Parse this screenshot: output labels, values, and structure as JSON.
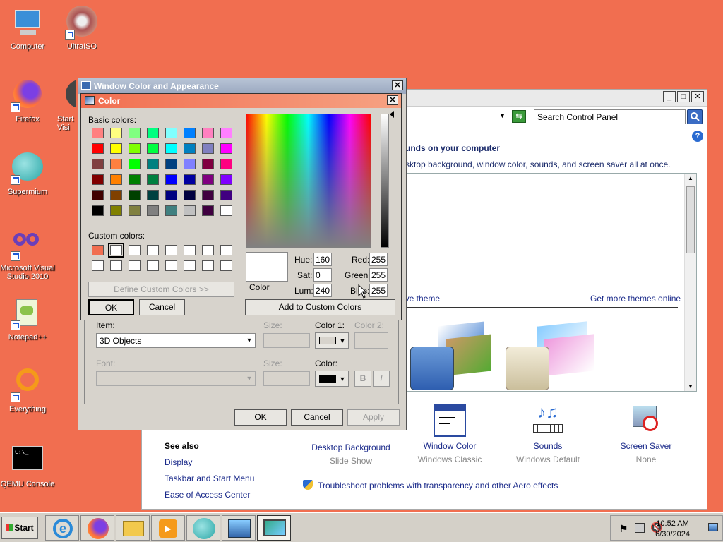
{
  "desktop": {
    "icons": [
      {
        "label": "Computer",
        "icon": "computer-icon"
      },
      {
        "label": "UltraISO",
        "icon": "ultraiso-icon"
      },
      {
        "label": "Firefox",
        "icon": "firefox-icon"
      },
      {
        "label": "Start Visi",
        "icon": "visio-icon"
      },
      {
        "label": "Supermium",
        "icon": "supermium-icon"
      },
      {
        "label": "Microsoft Visual Studio 2010",
        "icon": "visual-studio-icon"
      },
      {
        "label": "Notepad++",
        "icon": "notepadpp-icon"
      },
      {
        "label": "Everything",
        "icon": "everything-icon"
      },
      {
        "label": "QEMU Console",
        "icon": "console-icon"
      }
    ],
    "background": "#f16e50"
  },
  "control_panel": {
    "search_placeholder": "Search Control Panel",
    "heading": "unds on your computer",
    "subheading": "sktop background, window color, sounds, and screen saver all at once.",
    "save_theme": "Save theme",
    "more_themes": "Get more themes online",
    "bottom_items": [
      {
        "title": "Desktop Background",
        "subtitle": "Slide Show"
      },
      {
        "title": "Window Color",
        "subtitle": "Windows Classic"
      },
      {
        "title": "Sounds",
        "subtitle": "Windows Default"
      },
      {
        "title": "Screen Saver",
        "subtitle": "None"
      }
    ],
    "see_also": {
      "heading": "See also",
      "links": [
        "Display",
        "Taskbar and Start Menu",
        "Ease of Access Center"
      ]
    },
    "troubleshoot": "Troubleshoot problems with transparency and other Aero effects"
  },
  "wca_dialog": {
    "title": "Window Color and Appearance",
    "item_label": "Item:",
    "item_value": "3D Objects",
    "size_label": "Size:",
    "color1_label": "Color 1:",
    "color2_label": "Color 2:",
    "font_label": "Font:",
    "font_size_label": "Size:",
    "font_color_label": "Color:",
    "bold_label": "B",
    "italic_label": "I",
    "ok": "OK",
    "cancel": "Cancel",
    "apply": "Apply"
  },
  "color_dialog": {
    "title": "Color",
    "basic_colors_label": "Basic colors:",
    "custom_colors_label": "Custom colors:",
    "define_custom": "Define Custom Colors >>",
    "ok": "OK",
    "cancel": "Cancel",
    "add_custom": "Add to Custom Colors",
    "color_label": "Color",
    "hue_label": "Hue:",
    "hue": "160",
    "sat_label": "Sat:",
    "sat": "0",
    "lum_label": "Lum:",
    "lum": "240",
    "red_label": "Red:",
    "red": "255",
    "green_label": "Green:",
    "green": "255",
    "blue_label": "Blue:",
    "blue": "255",
    "basic_colors": [
      "#ff8080",
      "#ffff80",
      "#80ff80",
      "#00ff80",
      "#80ffff",
      "#0080ff",
      "#ff80c0",
      "#ff80ff",
      "#ff0000",
      "#ffff00",
      "#80ff00",
      "#00ff40",
      "#00ffff",
      "#0080c0",
      "#8080c0",
      "#ff00ff",
      "#804040",
      "#ff8040",
      "#00ff00",
      "#008080",
      "#004080",
      "#8080ff",
      "#800040",
      "#ff0080",
      "#800000",
      "#ff8000",
      "#008000",
      "#008040",
      "#0000ff",
      "#0000a0",
      "#800080",
      "#8000ff",
      "#400000",
      "#804000",
      "#004000",
      "#004040",
      "#000080",
      "#000040",
      "#400040",
      "#400080",
      "#000000",
      "#808000",
      "#808040",
      "#808080",
      "#408080",
      "#c0c0c0",
      "#400040",
      "#ffffff"
    ],
    "custom_colors": [
      "#f16e50",
      "#ffffff",
      "#ffffff",
      "#ffffff",
      "#ffffff",
      "#ffffff",
      "#ffffff",
      "#ffffff",
      "#ffffff",
      "#ffffff",
      "#ffffff",
      "#ffffff",
      "#ffffff",
      "#ffffff",
      "#ffffff",
      "#ffffff"
    ]
  },
  "taskbar": {
    "start": "Start",
    "time": "10:52 AM",
    "date": "6/30/2024"
  }
}
